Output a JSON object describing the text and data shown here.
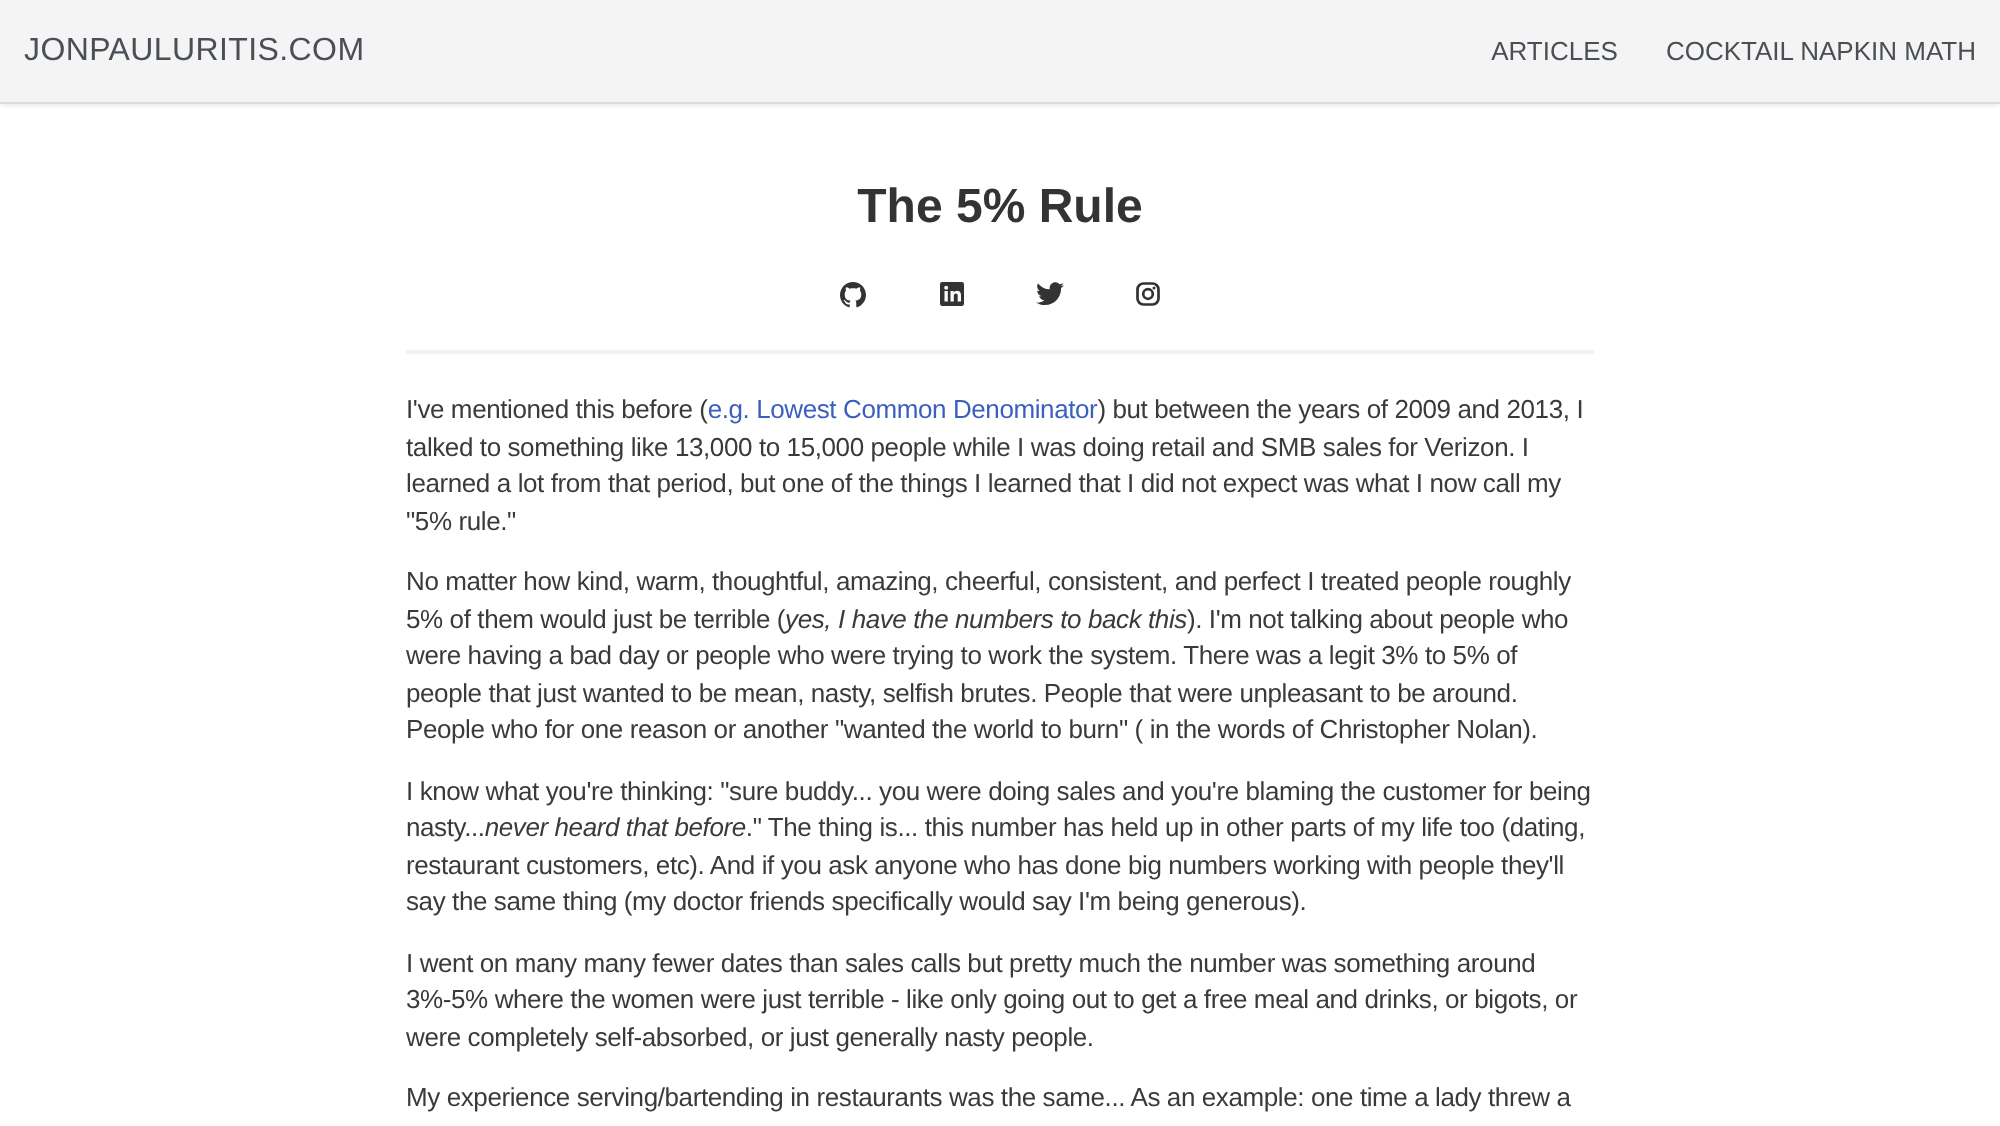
{
  "header": {
    "site_title": "JONPAULURITIS.COM",
    "nav": [
      {
        "label": "ARTICLES"
      },
      {
        "label": "COCKTAIL NAPKIN MATH"
      }
    ]
  },
  "article": {
    "title": "The 5% Rule",
    "social": [
      {
        "kind": "github"
      },
      {
        "kind": "linkedin"
      },
      {
        "kind": "twitter"
      },
      {
        "kind": "instagram"
      }
    ],
    "paragraphs": [
      [
        {
          "kind": "text",
          "text": "I've mentioned this before ("
        },
        {
          "kind": "link",
          "text": "e.g. Lowest Common Denominator"
        },
        {
          "kind": "text",
          "text": ") but between the years of 2009 and 2013, I talked to something like 13,000 to 15,000 people while I was doing retail and SMB sales for Verizon. I learned a lot from that period, but one of the things I learned that I did not expect was what I now call my \"5% rule.\""
        }
      ],
      [
        {
          "kind": "text",
          "text": "No matter how kind, warm, thoughtful, amazing, cheerful, consistent, and perfect I treated people roughly 5% of them would just be terrible (*yes, I have the numbers to back this*). I'm not talking about people who were having a bad day or people who were trying to work the system. There was a legit 3% to 5% of people that just wanted to be mean, nasty, selfish brutes. People that were unpleasant to be around. People who for one reason or another \"wanted the world to burn\" ( in the words of Christopher Nolan)."
        }
      ],
      [
        {
          "kind": "text",
          "text": "I know what you're thinking: \"sure buddy... you were doing sales and you're blaming the customer for being nasty...*never heard that before*.\" The thing is... this number has held up in other parts of my life too (dating, restaurant customers, etc). And if you ask anyone who has done big numbers working with people they'll say the same thing (my doctor friends specifically would say I'm being generous)."
        }
      ],
      [
        {
          "kind": "text",
          "text": "I went on many many fewer dates than sales calls but pretty much the number was something around 3%-5% where the women were just terrible - like only going out to get a free meal and drinks, or bigots, or were completely self-absorbed, or just generally nasty people."
        }
      ],
      [
        {
          "kind": "text",
          "text": "My experience serving/bartending in restaurants was the same... As an example: one time a lady threw a"
        }
      ]
    ]
  }
}
